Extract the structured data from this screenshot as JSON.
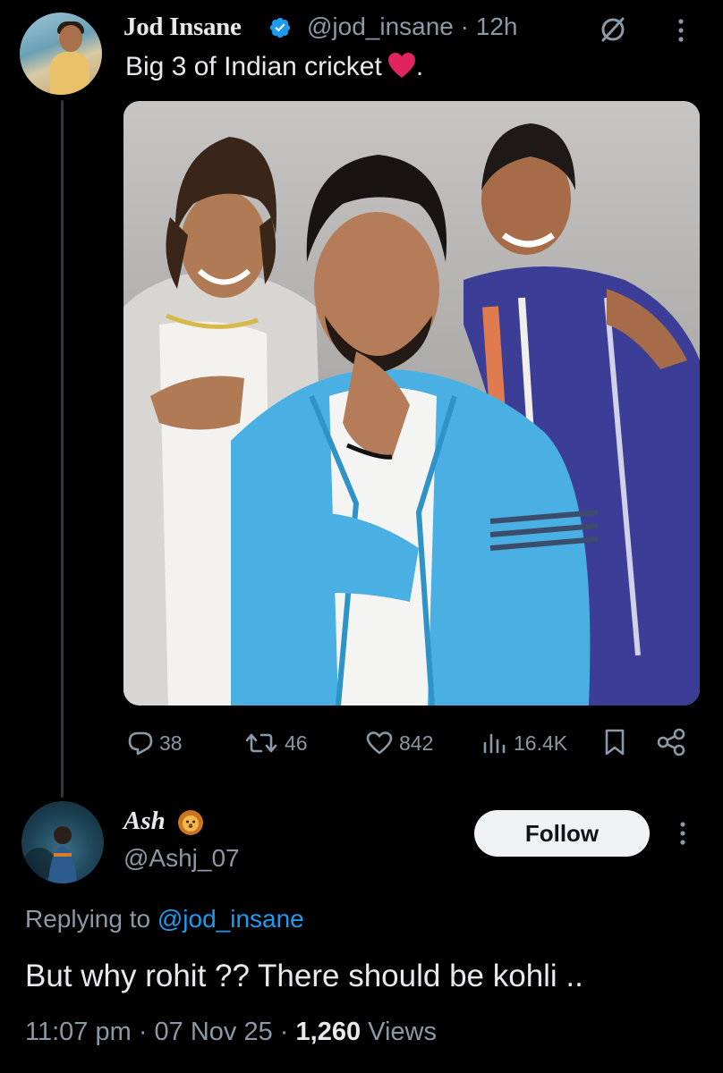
{
  "tweet": {
    "author_name": "Jod Insane",
    "handle": "@jod_insane",
    "time": "12h",
    "text": "Big 3 of Indian cricket",
    "text_suffix": ".",
    "stats": {
      "replies": "38",
      "reposts": "46",
      "likes": "842",
      "views": "16.4K"
    }
  },
  "reply": {
    "author_name": "Ash",
    "handle": "@Ashj_07",
    "follow_label": "Follow",
    "replying_prefix": "Replying to",
    "replying_to": "@jod_insane",
    "text": "But why rohit ?? There should be kohli ..",
    "time": "11:07 pm",
    "date": "07 Nov 25",
    "views_count": "1,260",
    "views_label": "Views"
  },
  "colors": {
    "background": "#000000",
    "text": "#e7e9ea",
    "muted": "#8b98a5",
    "accent": "#1d9bf0",
    "heart": "#e0245e",
    "follow_bg": "#eff3f4"
  },
  "icons": [
    "verified-badge-icon",
    "grok-icon",
    "more-icon",
    "heart-emoji-icon",
    "reply-icon",
    "repost-icon",
    "like-icon",
    "views-icon",
    "bookmark-icon",
    "share-icon",
    "lion-emoji-icon"
  ]
}
